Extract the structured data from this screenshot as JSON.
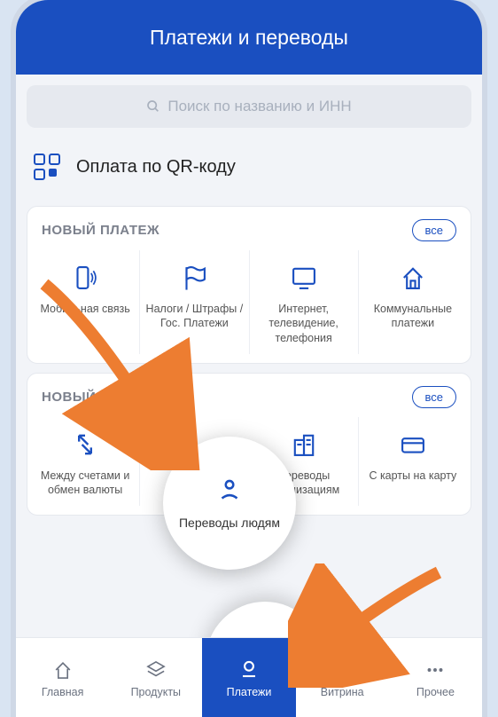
{
  "header": {
    "title": "Платежи и переводы"
  },
  "search": {
    "placeholder": "Поиск по названию и ИНН"
  },
  "qr": {
    "label": "Оплата по QR-коду"
  },
  "payment_section": {
    "title": "НОВЫЙ ПЛАТЕЖ",
    "all": "все",
    "tiles": [
      {
        "label": "Мобильная связь"
      },
      {
        "label": "Налоги / Штрафы / Гос. Платежи"
      },
      {
        "label": "Интернет, телевидение, телефония"
      },
      {
        "label": "Коммунальные платежи"
      }
    ]
  },
  "transfer_section": {
    "title": "НОВЫЙ ПЕРЕВОД",
    "all": "все",
    "tiles": [
      {
        "label": "Между счетами и обмен валюты"
      },
      {
        "label": "Переводы людям"
      },
      {
        "label": "Переводы организациям"
      },
      {
        "label": "С карты на карту"
      }
    ]
  },
  "nav": {
    "items": [
      {
        "label": "Главная"
      },
      {
        "label": "Продукты"
      },
      {
        "label": "Платежи"
      },
      {
        "label": "Витрина"
      },
      {
        "label": "Прочее"
      }
    ]
  }
}
